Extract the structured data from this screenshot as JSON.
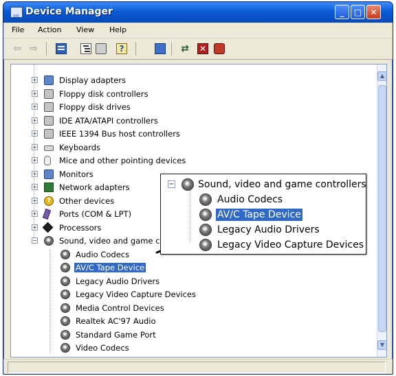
{
  "window": {
    "title": "Device Manager",
    "controls": {
      "minimize": "_",
      "maximize": "□",
      "close": "✕"
    }
  },
  "menu": [
    "File",
    "Action",
    "View",
    "Help"
  ],
  "toolbar": {
    "icons": [
      "back-arrow-icon",
      "forward-arrow-icon",
      "properties-icon",
      "tree-view-icon",
      "print-icon",
      "help-icon",
      "scan-hardware-icon",
      "update-driver-icon",
      "disable-device-icon",
      "uninstall-device-icon"
    ]
  },
  "tree": {
    "categories": [
      {
        "label": "Display adapters",
        "icon": "monitor-icon",
        "expanded": false
      },
      {
        "label": "Floppy disk controllers",
        "icon": "drive-controller-icon",
        "expanded": false
      },
      {
        "label": "Floppy disk drives",
        "icon": "floppy-drive-icon",
        "expanded": false
      },
      {
        "label": "IDE ATA/ATAPI controllers",
        "icon": "ide-controller-icon",
        "expanded": false
      },
      {
        "label": "IEEE 1394 Bus host controllers",
        "icon": "ieee1394-icon",
        "expanded": false
      },
      {
        "label": "Keyboards",
        "icon": "keyboard-icon",
        "expanded": false
      },
      {
        "label": "Mice and other pointing devices",
        "icon": "mouse-icon",
        "expanded": false
      },
      {
        "label": "Monitors",
        "icon": "monitor-icon",
        "expanded": false
      },
      {
        "label": "Network adapters",
        "icon": "network-adapter-icon",
        "expanded": false
      },
      {
        "label": "Other devices",
        "icon": "other-devices-icon",
        "expanded": false
      },
      {
        "label": "Ports (COM & LPT)",
        "icon": "port-icon",
        "expanded": false
      },
      {
        "label": "Processors",
        "icon": "processor-icon",
        "expanded": false
      },
      {
        "label": "Sound, video and game controllers",
        "icon": "sound-icon",
        "expanded": true
      }
    ],
    "sound_children": [
      {
        "label": "Audio Codecs",
        "selected": false
      },
      {
        "label": "AV/C Tape Device",
        "selected": true
      },
      {
        "label": "Legacy Audio Drivers",
        "selected": false
      },
      {
        "label": "Legacy Video Capture Devices",
        "selected": false
      },
      {
        "label": "Media Control Devices",
        "selected": false
      },
      {
        "label": "Realtek AC'97 Audio",
        "selected": false
      },
      {
        "label": "Standard Game Port",
        "selected": false
      },
      {
        "label": "Video Codecs",
        "selected": false
      }
    ],
    "expander": {
      "collapsed": "+",
      "expanded": "−"
    }
  },
  "callout": {
    "parent_label": "Sound, video and game controllers",
    "children": [
      {
        "label": "Audio Codecs",
        "selected": false
      },
      {
        "label": "AV/C Tape Device",
        "selected": true
      },
      {
        "label": "Legacy Audio Drivers",
        "selected": false
      },
      {
        "label": "Legacy Video Capture Devices",
        "selected": false
      }
    ]
  },
  "colors": {
    "titlebar": "#0a5bd6",
    "selection": "#316ac5",
    "window_frame": "#ece9d8"
  }
}
